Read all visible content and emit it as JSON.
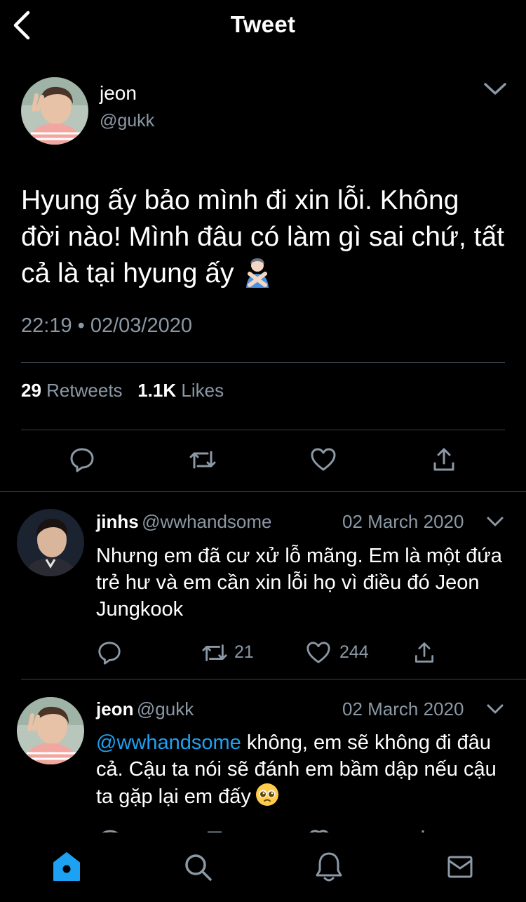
{
  "header": {
    "title": "Tweet",
    "back_icon": "chevron-left-icon"
  },
  "main_tweet": {
    "name": "jeon",
    "handle": "@gukk",
    "text": "Hyung ấy bảo mình đi xin lỗi. Không đời nào! Mình đâu có làm gì sai chứ, tất cả là tại hyung ấy",
    "emoji": "person-gesturing-no-emoji",
    "time": "22:19",
    "separator": "•",
    "date": "02/03/2020",
    "retweets": "29",
    "retweets_label": "Retweets",
    "likes": "1.1K",
    "likes_label": "Likes"
  },
  "replies": [
    {
      "name": "jinhs",
      "handle": "@wwhandsome",
      "date": "02 March 2020",
      "text": "Nhưng em đã cư xử lỗ mãng. Em là một đứa trẻ hư và em cần xin lỗi họ vì điều đó Jeon Jungkook",
      "retweets": "21",
      "likes": "244"
    },
    {
      "name": "jeon",
      "handle": "@gukk",
      "date": "02 March 2020",
      "mention": "@wwhandsome",
      "text": " không, em sẽ không đi đâu cả. Cậu ta nói sẽ đánh em bầm dập nếu cậu ta gặp lại em đấy",
      "emoji": "pleading-face-emoji"
    }
  ],
  "tabbar": {
    "active": "home"
  },
  "colors": {
    "background": "#000000",
    "text": "#ffffff",
    "secondary_text": "#8b98a5",
    "accent": "#1da1f2",
    "divider": "#38444d"
  }
}
